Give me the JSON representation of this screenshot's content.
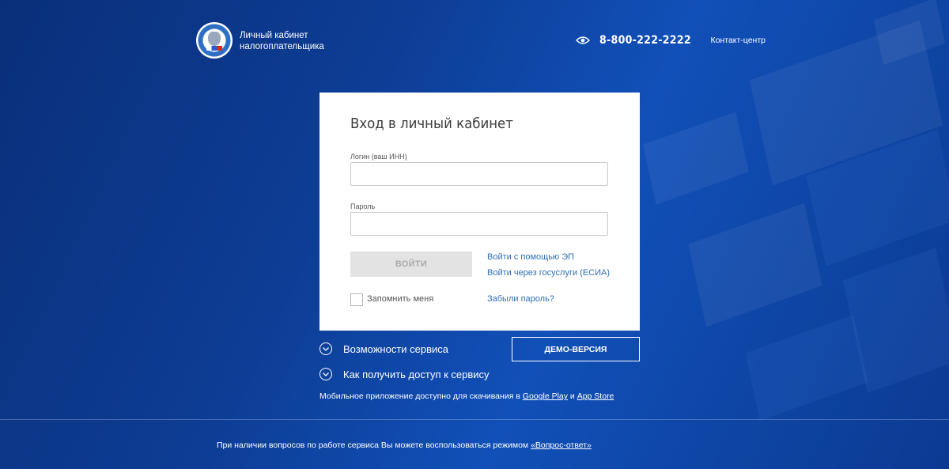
{
  "header": {
    "brand_line1": "Личный кабинет",
    "brand_line2": "налогоплательщика",
    "phone": "8-800-222-2222",
    "contact_label": "Контакт-центр"
  },
  "login": {
    "title": "Вход в личный кабинет",
    "login_label": "Логин (ваш ИНН)",
    "login_value": "",
    "password_label": "Пароль",
    "password_value": "",
    "submit_label": "ВОЙТИ",
    "link_ep": "Войти с помощью ЭП",
    "link_esia": "Войти через госуслуги (ЕСИА)",
    "remember_label": "Запомнить меня",
    "forgot_label": "Забыли пароль?"
  },
  "features": {
    "item1": "Возможности сервиса",
    "item2": "Как получить доступ к сервису",
    "demo_label": "ДЕМО-ВЕРСИЯ"
  },
  "mobile": {
    "text_before": "Мобильное приложение доступно для скачивания в ",
    "google_play": "Google Play",
    "and": " и ",
    "app_store": "App Store"
  },
  "footer": {
    "text": "При наличии вопросов по работе сервиса Вы можете воспользоваться режимом ",
    "link": "«Вопрос-ответ»"
  },
  "colors": {
    "background": "#0d3d95",
    "link": "#2f6fb4",
    "disabled_button": "#e3e3e3"
  }
}
